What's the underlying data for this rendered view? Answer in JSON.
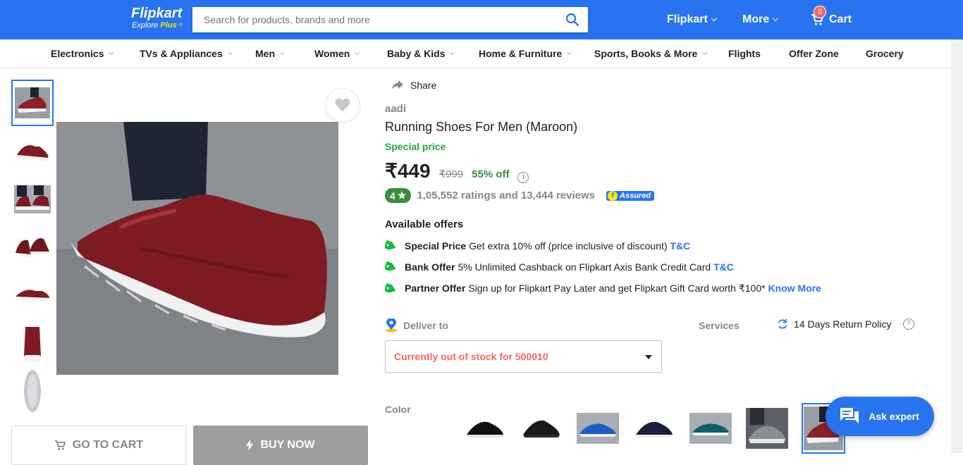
{
  "header": {
    "logo_name": "Flipkart",
    "logo_sub": "Explore",
    "logo_plus": "Plus",
    "search_placeholder": "Search for products, brands and more",
    "account_label": "Flipkart",
    "more_label": "More",
    "cart_label": "Cart",
    "cart_count": "8"
  },
  "categories": [
    "Electronics",
    "TVs & Appliances",
    "Men",
    "Women",
    "Baby & Kids",
    "Home & Furniture",
    "Sports, Books & More",
    "Flights",
    "Offer Zone",
    "Grocery"
  ],
  "gallery": {
    "selected_index": 0,
    "thumb_count": 7
  },
  "actions": {
    "go_to_cart": "GO TO CART",
    "buy_now": "BUY NOW"
  },
  "product": {
    "share_label": "Share",
    "brand": "aadi",
    "title": "Running Shoes For Men  (Maroon)",
    "special_price_label": "Special price",
    "price": "₹449",
    "mrp": "₹999",
    "discount": "55% off",
    "rating": "4",
    "ratings_text": "1,05,552 ratings and 13,444 reviews",
    "assured_label": "Assured"
  },
  "offers": {
    "heading": "Available offers",
    "items": [
      {
        "type": "Special Price",
        "text": "Get extra 10% off (price inclusive of discount)",
        "link": "T&C"
      },
      {
        "type": "Bank Offer",
        "text": "5% Unlimited Cashback on Flipkart Axis Bank Credit Card",
        "link": "T&C"
      },
      {
        "type": "Partner Offer",
        "text": "Sign up for Flipkart Pay Later and get Flipkart Gift Card worth ₹100*",
        "link": "Know More"
      }
    ]
  },
  "delivery": {
    "label": "Deliver to",
    "status": "Currently out of stock for 500010",
    "services_label": "Services",
    "return_policy": "14 Days Return Policy"
  },
  "color": {
    "label": "Color",
    "swatch_count": 7,
    "selected_index": 6
  },
  "chat": {
    "label": "Ask expert"
  },
  "colors": {
    "brand_blue": "#2874f0",
    "green": "#388e3c",
    "out_of_stock": "#ff6161"
  }
}
